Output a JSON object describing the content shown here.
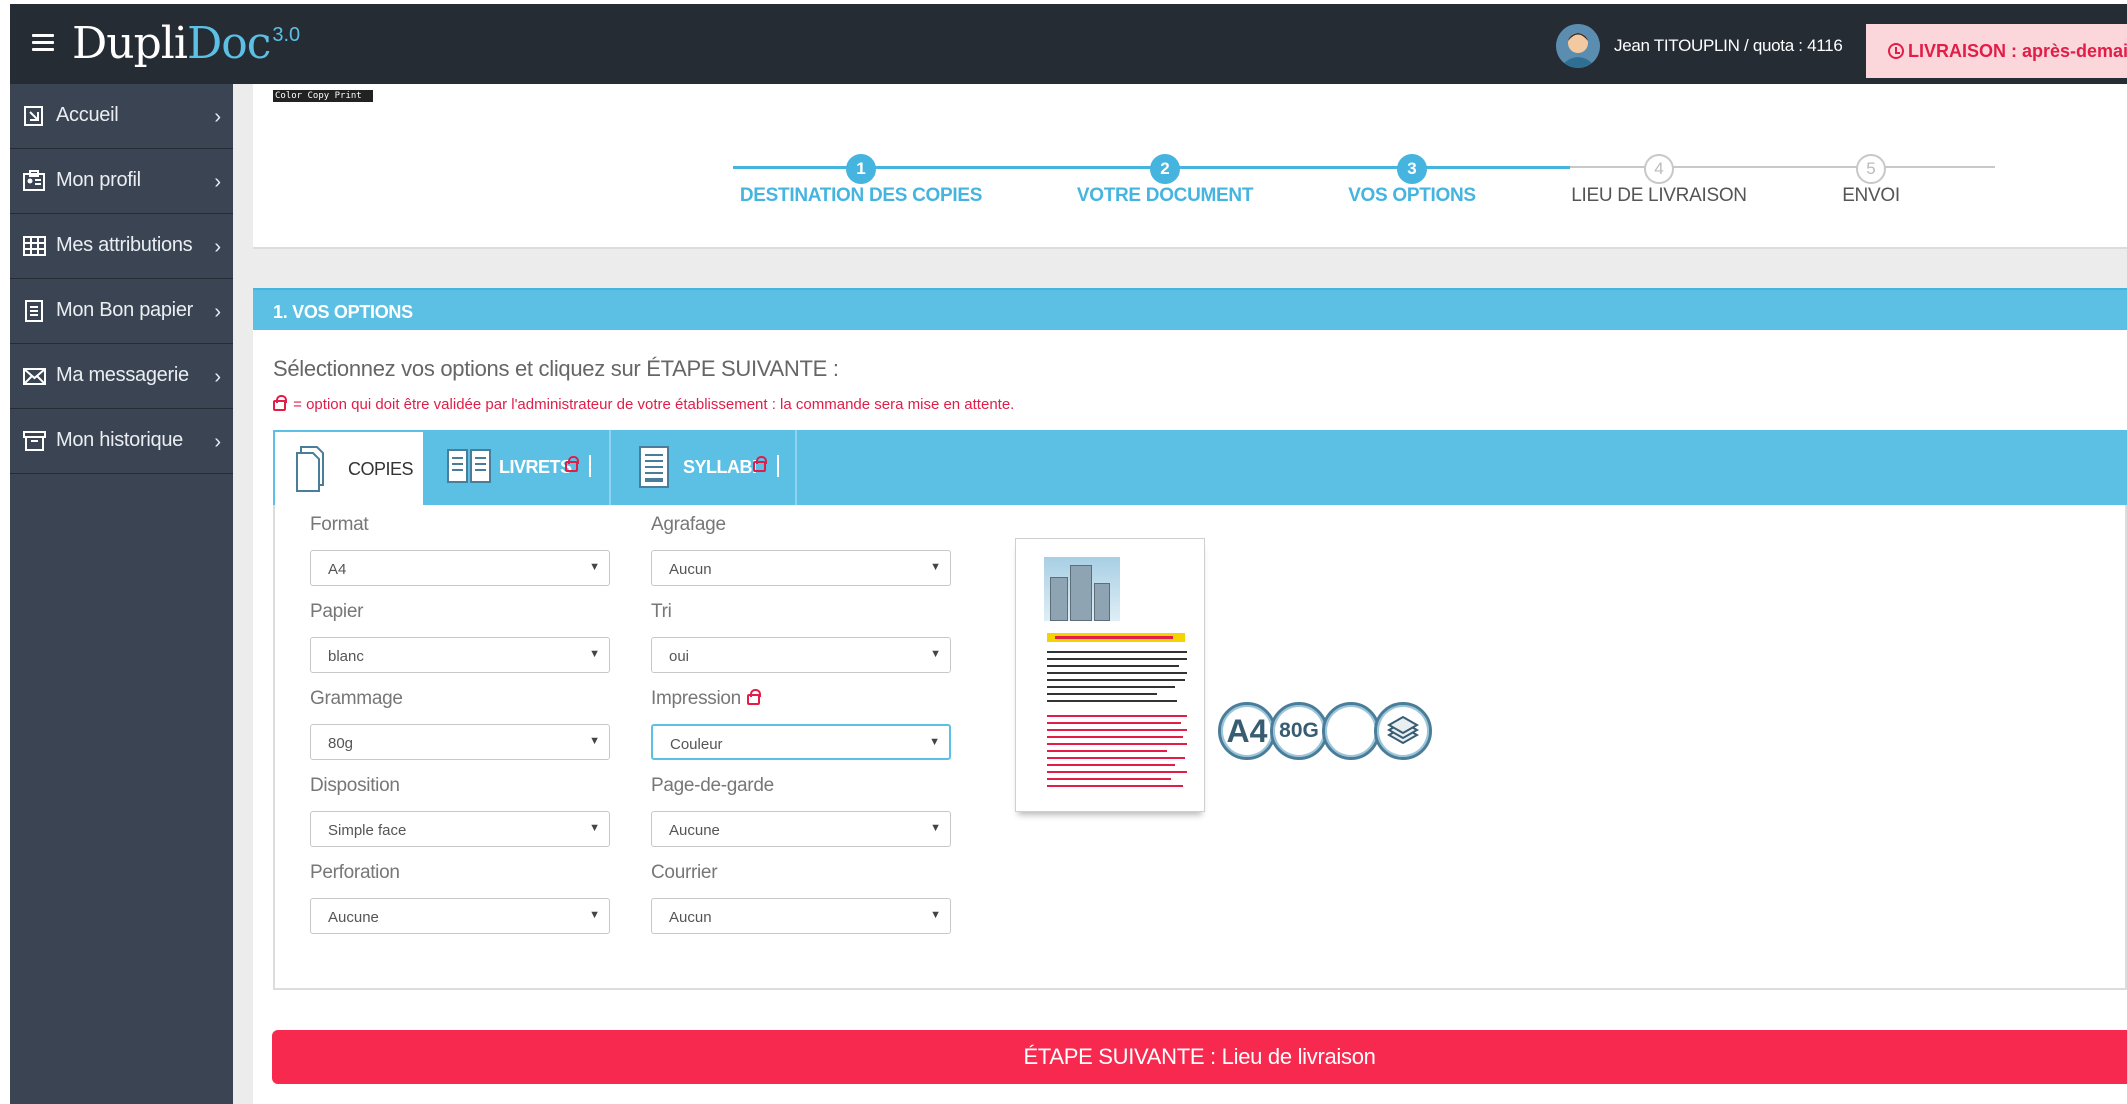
{
  "app": {
    "logo_main": "Dupli",
    "logo_accent": "Doc",
    "logo_version": "3.0",
    "user_info": "Jean TITOUPLIN / quota : 4116",
    "delivery_badge": "LIVRAISON : après-demain",
    "brand_stub": "Color Copy Print"
  },
  "sidebar": {
    "items": [
      {
        "label": "Accueil",
        "icon": "home-icon"
      },
      {
        "label": "Mon profil",
        "icon": "profile-icon"
      },
      {
        "label": "Mes attributions",
        "icon": "table-icon"
      },
      {
        "label": "Mon Bon papier",
        "icon": "document-icon"
      },
      {
        "label": "Ma messagerie",
        "icon": "envelope-icon"
      },
      {
        "label": "Mon historique",
        "icon": "archive-icon"
      }
    ]
  },
  "stepper": {
    "steps": [
      {
        "num": "1",
        "label": "DESTINATION DES COPIES",
        "state": "done"
      },
      {
        "num": "2",
        "label": "VOTRE DOCUMENT",
        "state": "done"
      },
      {
        "num": "3",
        "label": "VOS OPTIONS",
        "state": "current"
      },
      {
        "num": "4",
        "label": "LIEU DE LIVRAISON",
        "state": "todo"
      },
      {
        "num": "5",
        "label": "ENVOI",
        "state": "todo"
      }
    ]
  },
  "options": {
    "header": "1. VOS OPTIONS",
    "instruction": "Sélectionnez vos options et cliquez sur ÉTAPE SUIVANTE :",
    "warning": " = option qui doit être validée par l'administrateur de votre établissement : la commande sera mise en attente.",
    "tabs": [
      {
        "label": "COPIES",
        "locked": false
      },
      {
        "label": "LIVRETS",
        "locked": true
      },
      {
        "label": "SYLLABI",
        "locked": true
      }
    ],
    "fields": {
      "format": {
        "label": "Format",
        "value": "A4"
      },
      "agrafage": {
        "label": "Agrafage",
        "value": "Aucun"
      },
      "papier": {
        "label": "Papier",
        "value": "blanc"
      },
      "tri": {
        "label": "Tri",
        "value": "oui"
      },
      "grammage": {
        "label": "Grammage",
        "value": "80g"
      },
      "impression": {
        "label": "Impression",
        "value": "Couleur",
        "locked": true
      },
      "disposition": {
        "label": "Disposition",
        "value": "Simple face"
      },
      "page_de_garde": {
        "label": "Page-de-garde",
        "value": "Aucune"
      },
      "perforation": {
        "label": "Perforation",
        "value": "Aucune"
      },
      "courrier": {
        "label": "Courrier",
        "value": "Aucun"
      }
    },
    "badges": [
      "A4",
      "80G",
      "",
      "stack-icon"
    ],
    "next_button": "ÉTAPE SUIVANTE : Lieu de livraison"
  },
  "colors": {
    "accent": "#5bc0e4",
    "topbar": "#252c34",
    "sidebar": "#3a4452",
    "alert": "#e11d48",
    "next_button": "#f8294f"
  }
}
